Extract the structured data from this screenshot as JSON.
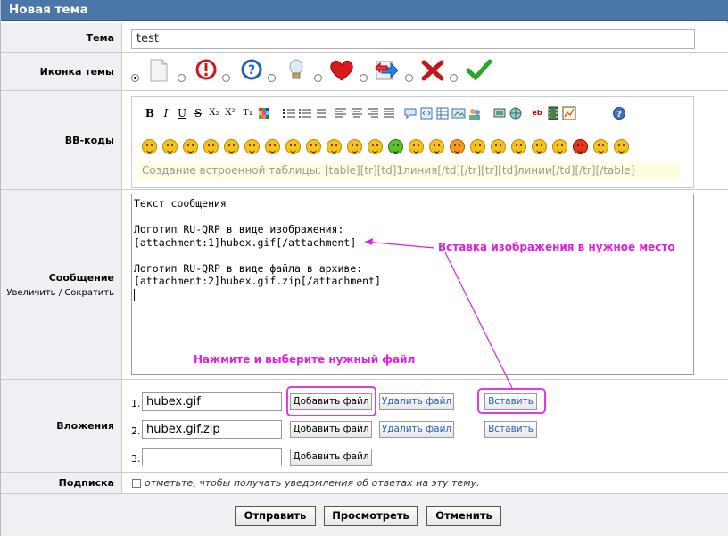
{
  "header": {
    "title": "Новая тема"
  },
  "topic": {
    "label": "Тема",
    "value": "test"
  },
  "icon_row": {
    "label": "Иконка темы",
    "icons": [
      "blank-page-icon",
      "exclamation-icon",
      "question-icon",
      "lightbulb-icon",
      "heart-icon",
      "arrow-icon",
      "red-x-icon",
      "check-icon"
    ]
  },
  "bbcodes": {
    "label": "BB-коды",
    "toolbar": [
      "B",
      "I",
      "U",
      "S",
      "X₂",
      "X²",
      "Tт"
    ],
    "hint": "Создание встроенной таблицы: [table][tr][td]1линия[/td][/tr][tr][td]линии[/td][/tr][/table]"
  },
  "message": {
    "label": "Сообщение",
    "enlarge": "Увеличить",
    "separator": "/",
    "shrink": "Сократить",
    "lines": [
      "Текст сообщения",
      "",
      "Логотип RU-QRP в виде изображения:",
      "[attachment:1]hubex.gif[/attachment]",
      "",
      "Логотип RU-QRP в виде файла в архиве:",
      "[attachment:2]hubex.gif.zip[/attachment]"
    ]
  },
  "attachments": {
    "label": "Вложения",
    "items": [
      {
        "num": "1.",
        "value": "hubex.gif",
        "add": "Добавить файл",
        "delete": "Удалить файл",
        "insert": "Вставить"
      },
      {
        "num": "2.",
        "value": "hubex.gif.zip",
        "add": "Добавить файл",
        "delete": "Удалить файл",
        "insert": "Вставить"
      },
      {
        "num": "3.",
        "value": "",
        "add": "Добавить файл"
      }
    ]
  },
  "subscription": {
    "label": "Подписка",
    "text": "отметьте, чтобы получать уведомления об ответах на эту тему."
  },
  "actions": {
    "submit": "Отправить",
    "preview": "Просмотреть",
    "cancel": "Отменить"
  },
  "annotations": {
    "insert_note": "Вставка изображения в нужное место",
    "add_note": "Нажмите и выберите нужный файл",
    "color": "#e020e0"
  }
}
